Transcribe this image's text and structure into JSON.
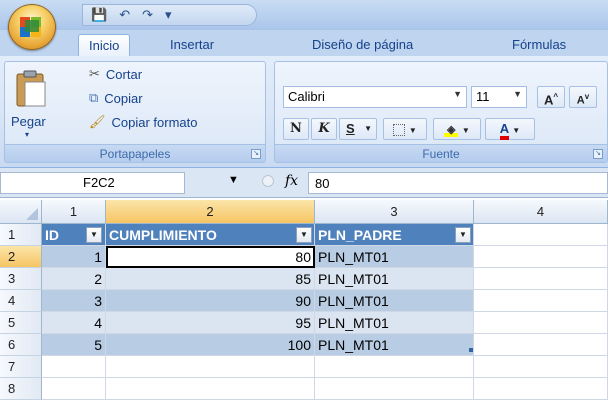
{
  "tabs": [
    {
      "label": "Inicio",
      "active": true
    },
    {
      "label": "Insertar"
    },
    {
      "label": "Diseño de página"
    },
    {
      "label": "Fórmulas"
    }
  ],
  "clipboard": {
    "paste_label": "Pegar",
    "cut_label": "Cortar",
    "copy_label": "Copiar",
    "format_painter_label": "Copiar formato",
    "group_label": "Portapapeles"
  },
  "font": {
    "name": "Calibri",
    "size": "11",
    "bold": "N",
    "italic": "K",
    "underline": "S",
    "grow": "A",
    "shrink": "A",
    "group_label": "Fuente"
  },
  "formula_bar": {
    "name_box": "F2C2",
    "fx": "fx",
    "value": "80"
  },
  "grid": {
    "column_headers": [
      "1",
      "2",
      "3",
      "4"
    ],
    "row_headers": [
      "1",
      "2",
      "3",
      "4",
      "5",
      "6",
      "7",
      "8"
    ],
    "table_headers": [
      "ID",
      "CUMPLIMIENTO",
      "PLN_PADRE"
    ],
    "rows": [
      {
        "id": "1",
        "cumplimiento": "80",
        "pln_padre": "PLN_MT01"
      },
      {
        "id": "2",
        "cumplimiento": "85",
        "pln_padre": "PLN_MT01"
      },
      {
        "id": "3",
        "cumplimiento": "90",
        "pln_padre": "PLN_MT01"
      },
      {
        "id": "4",
        "cumplimiento": "95",
        "pln_padre": "PLN_MT01"
      },
      {
        "id": "5",
        "cumplimiento": "100",
        "pln_padre": "PLN_MT01"
      }
    ]
  },
  "colors": {
    "table_header": "#4f81bd",
    "band_dark": "#b8cce4",
    "band_light": "#dbe5f1",
    "selection_header": "#f6c564"
  }
}
